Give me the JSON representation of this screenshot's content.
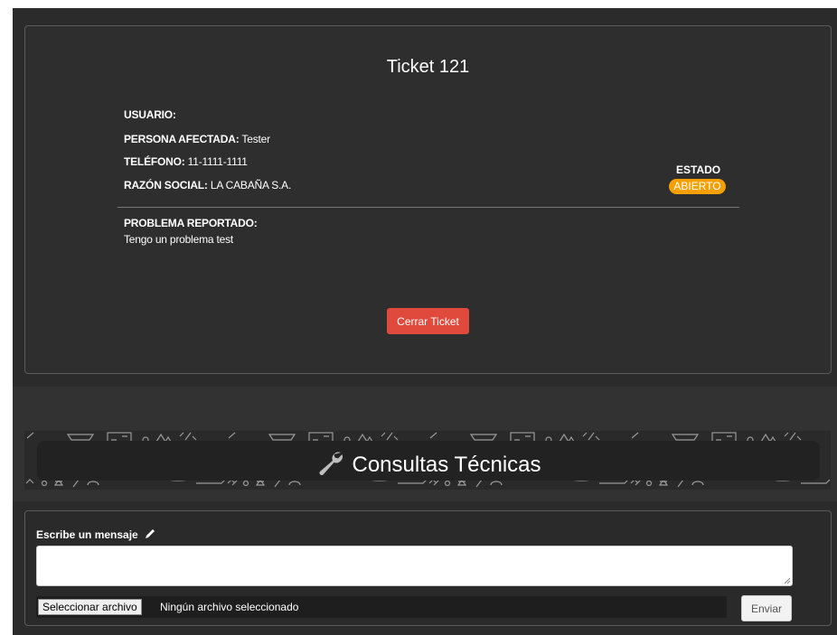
{
  "ticket": {
    "title": "Ticket 121",
    "usuario_label": "USUARIO:",
    "usuario_value": "",
    "persona_label": "PERSONA AFECTADA:",
    "persona_value": "Tester",
    "telefono_label": "TELÉFONO:",
    "telefono_value": "11-1111-1111",
    "razon_label": "RAZÓN SOCIAL:",
    "razon_value": "LA CABAÑA S.A.",
    "estado_label": "ESTADO",
    "estado_value": "ABIERTO",
    "problema_label": "PROBLEMA REPORTADO:",
    "problema_value": "Tengo un problema test",
    "close_label": "Cerrar Ticket"
  },
  "banner": {
    "title": "Consultas Técnicas",
    "icon": "wrench-icon"
  },
  "message": {
    "label": "Escribe un mensaje",
    "icon": "pencil-icon",
    "value": "",
    "file_button_label": "Seleccionar archivo",
    "file_status": "Ningún archivo seleccionado",
    "send_label": "Enviar"
  },
  "colors": {
    "background": "#2b2b2b",
    "status_badge": "#f5a000",
    "close_button": "#e04a3d"
  }
}
